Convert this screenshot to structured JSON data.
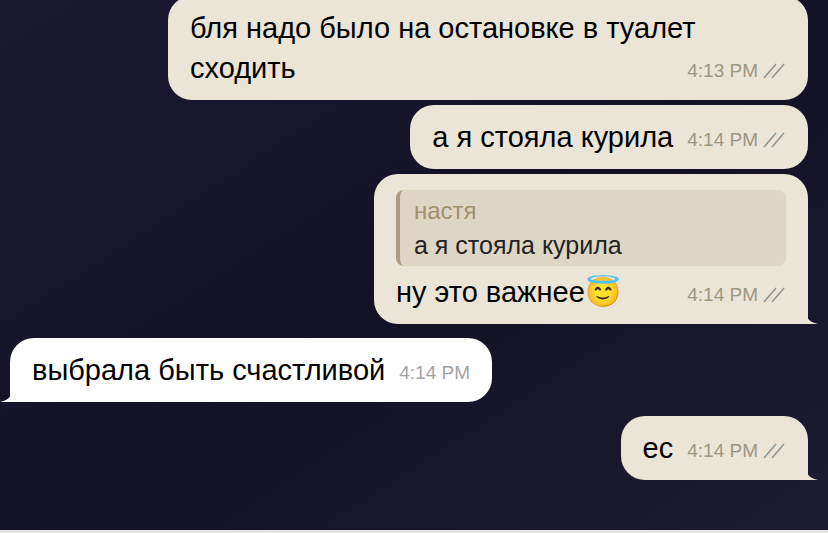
{
  "messages": [
    {
      "kind": "outgoing",
      "text": "бля надо было на остановке в туалет сходить",
      "time": "4:13 PM",
      "read": true,
      "tail": false
    },
    {
      "kind": "outgoing",
      "text": "а я стояла курила",
      "time": "4:14 PM",
      "read": true,
      "tail": false
    },
    {
      "kind": "outgoing",
      "reply": {
        "name": "настя",
        "text": "а я стояла курила"
      },
      "text": "ну это важнее😇",
      "time": "4:14 PM",
      "read": true,
      "tail": true
    },
    {
      "kind": "incoming",
      "text": "выбрала быть счастливой",
      "time": "4:14 PM",
      "tail": true
    },
    {
      "kind": "outgoing",
      "text": "ес",
      "time": "4:14 PM",
      "read": true,
      "tail": true
    }
  ]
}
